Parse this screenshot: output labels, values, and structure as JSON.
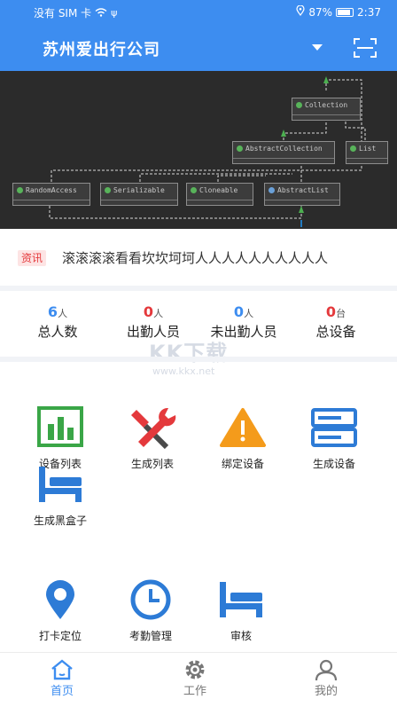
{
  "status": {
    "carrier": "没有 SIM 卡",
    "battery": "87%",
    "time": "2:37"
  },
  "header": {
    "title": "苏州爱出行公司"
  },
  "banner": {
    "classes": [
      "Collection",
      "AbstractCollection",
      "List",
      "RandomAccess",
      "Serializable",
      "Cloneable",
      "AbstractList"
    ]
  },
  "news": {
    "badge": "资讯",
    "text": "滚滚滚滚看看坎坎坷坷人人人人人人人人人人"
  },
  "stats": [
    {
      "value": "6",
      "unit": "人",
      "label": "总人数",
      "color": "#3d8df0"
    },
    {
      "value": "0",
      "unit": "人",
      "label": "出勤人员",
      "color": "#e4393c"
    },
    {
      "value": "0",
      "unit": "人",
      "label": "未出勤人员",
      "color": "#3d8df0"
    },
    {
      "value": "0",
      "unit": "台",
      "label": "总设备",
      "color": "#e4393c"
    }
  ],
  "watermark": {
    "text": "KK下载",
    "url": "www.kkx.net"
  },
  "grid1": [
    {
      "label": "设备列表",
      "icon": "bar-chart-icon"
    },
    {
      "label": "生成列表",
      "icon": "tools-icon"
    },
    {
      "label": "绑定设备",
      "icon": "warning-icon"
    },
    {
      "label": "生成设备",
      "icon": "server-icon"
    },
    {
      "label": "生成黑盒子",
      "icon": "bed-icon"
    }
  ],
  "grid2": [
    {
      "label": "打卡定位",
      "icon": "location-pin-icon"
    },
    {
      "label": "考勤管理",
      "icon": "clock-icon"
    },
    {
      "label": "审核",
      "icon": "bed-icon"
    }
  ],
  "tabs": [
    {
      "label": "首页",
      "icon": "home-icon",
      "active": true
    },
    {
      "label": "工作",
      "icon": "gear-icon",
      "active": false
    },
    {
      "label": "我的",
      "icon": "user-icon",
      "active": false
    }
  ],
  "colors": {
    "primary": "#3d8df0",
    "accent_red": "#e4393c",
    "icon_green": "#3aa647",
    "icon_orange": "#f49b1b",
    "icon_blue": "#2d7bd6"
  }
}
